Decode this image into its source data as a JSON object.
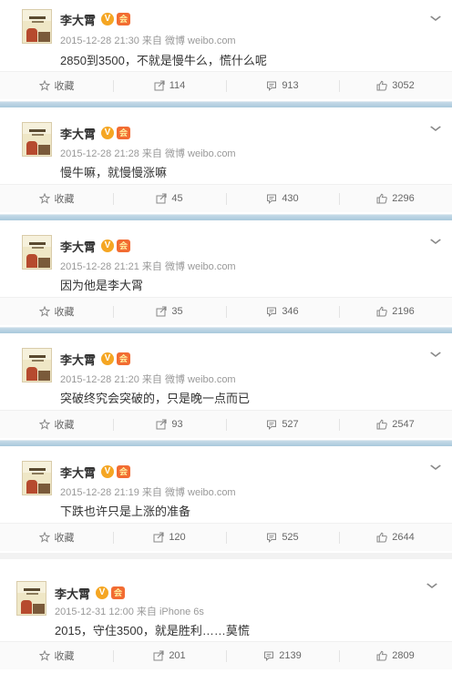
{
  "posts": [
    {
      "author": "李大霄",
      "meta": "2015-12-28 21:30 来自 微博 weibo.com",
      "text": "2850到3500，不就是慢牛么，慌什么呢",
      "favorite_label": "收藏",
      "reposts": "114",
      "comments": "913",
      "likes": "3052"
    },
    {
      "author": "李大霄",
      "meta": "2015-12-28 21:28 来自 微博 weibo.com",
      "text": "慢牛嘛，就慢慢涨嘛",
      "favorite_label": "收藏",
      "reposts": "45",
      "comments": "430",
      "likes": "2296"
    },
    {
      "author": "李大霄",
      "meta": "2015-12-28 21:21 来自 微博 weibo.com",
      "text": "因为他是李大霄",
      "favorite_label": "收藏",
      "reposts": "35",
      "comments": "346",
      "likes": "2196"
    },
    {
      "author": "李大霄",
      "meta": "2015-12-28 21:20 来自 微博 weibo.com",
      "text": "突破终究会突破的，只是晚一点而已",
      "favorite_label": "收藏",
      "reposts": "93",
      "comments": "527",
      "likes": "2547"
    },
    {
      "author": "李大霄",
      "meta": "2015-12-28 21:19 来自 微博 weibo.com",
      "text": "下跌也许只是上涨的准备",
      "favorite_label": "收藏",
      "reposts": "120",
      "comments": "525",
      "likes": "2644"
    },
    {
      "author": "李大霄",
      "meta": "2015-12-31 12:00 来自 iPhone 6s",
      "text": "2015，守住3500，就是胜利……莫慌",
      "favorite_label": "收藏",
      "reposts": "201",
      "comments": "2139",
      "likes": "2809"
    }
  ],
  "badges": {
    "verified": "V",
    "level": "会"
  },
  "icons": {
    "favorite": "star-outline-icon",
    "repost": "repost-arrow-icon",
    "comment": "comment-bubble-icon",
    "like": "thumbs-up-icon",
    "menu": "chevron-down-icon"
  },
  "colors": {
    "divider": "#b4cfe0",
    "verified_badge": "#f5a623",
    "level_badge": "#f26c32",
    "meta_text": "#999999"
  }
}
